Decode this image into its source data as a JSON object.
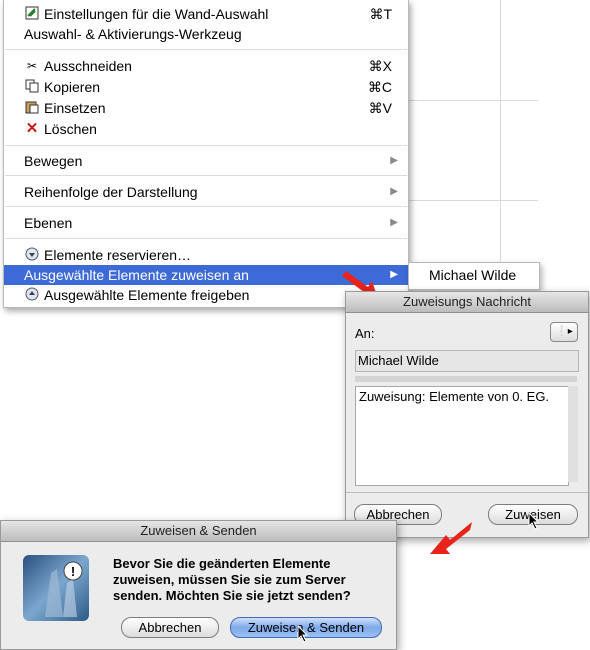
{
  "context_menu": {
    "items": [
      {
        "label": "Einstellungen für die Wand-Auswahl",
        "shortcut": "⌘T",
        "icon": "wall-settings-icon"
      },
      {
        "label": "Auswahl- & Aktivierungs-Werkzeug",
        "shortcut": "",
        "icon": ""
      },
      {
        "label": "Ausschneiden",
        "shortcut": "⌘X",
        "icon": "scissors-icon"
      },
      {
        "label": "Kopieren",
        "shortcut": "⌘C",
        "icon": "copy-icon"
      },
      {
        "label": "Einsetzen",
        "shortcut": "⌘V",
        "icon": "paste-icon"
      },
      {
        "label": "Löschen",
        "shortcut": "",
        "icon": "delete-x-icon"
      },
      {
        "label": "Bewegen",
        "submenu": true
      },
      {
        "label": "Reihenfolge der Darstellung",
        "submenu": true
      },
      {
        "label": "Ebenen",
        "submenu": true
      },
      {
        "label": "Elemente reservieren…",
        "icon": "reserve-down-arrow-icon"
      },
      {
        "label": "Ausgewählte Elemente zuweisen an",
        "submenu": true,
        "selected": true
      },
      {
        "label": "Ausgewählte Elemente freigeben",
        "icon": "release-up-arrow-icon"
      }
    ]
  },
  "submenu": {
    "item": "Michael Wilde"
  },
  "assign_dialog": {
    "title": "Zuweisungs Nachricht",
    "to_label": "An:",
    "recipient": "Michael Wilde",
    "message": "Zuweisung: Elemente von 0. EG.",
    "cancel_label": "Abbrechen",
    "assign_label": "Zuweisen"
  },
  "send_dialog": {
    "title": "Zuweisen & Senden",
    "message": "Bevor Sie die geänderten Elemente zuweisen, müssen Sie sie zum Server senden. Möchten Sie sie jetzt senden?",
    "cancel_label": "Abbrechen",
    "confirm_label": "Zuweisen & Senden"
  },
  "colors": {
    "highlight": "#3d6ad6",
    "arrow": "#e8231a"
  }
}
